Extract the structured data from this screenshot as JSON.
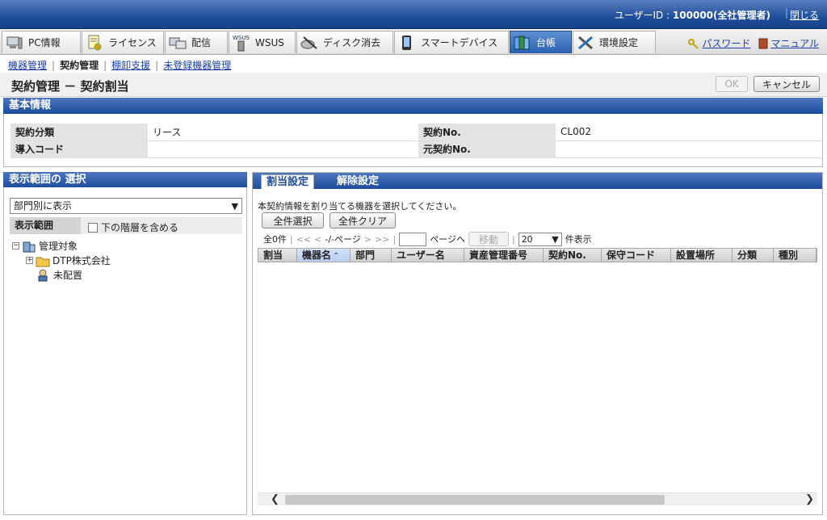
{
  "header": {
    "user_label": "ユーザーID : ",
    "user_id": "100000(全社管理者)",
    "close": "閉じる"
  },
  "nav": {
    "tabs": [
      {
        "label": "PC情報",
        "icon": "pc-icon"
      },
      {
        "label": "ライセンス",
        "icon": "license-icon"
      },
      {
        "label": "配信",
        "icon": "distribution-icon"
      },
      {
        "label": "WSUS",
        "icon": "wsus-icon"
      },
      {
        "label": "ディスク消去",
        "icon": "disk-erase-icon"
      },
      {
        "label": "スマートデバイス",
        "icon": "smart-device-icon"
      },
      {
        "label": "台帳",
        "icon": "ledger-icon"
      },
      {
        "label": "環境設定",
        "icon": "settings-icon"
      }
    ],
    "active_tab": "台帳",
    "password": "パスワード",
    "manual": "マニュアル"
  },
  "subnav": {
    "items": [
      "機器管理",
      "契約管理",
      "棚卸支援",
      "未登録機器管理"
    ],
    "current": "契約管理"
  },
  "page": {
    "title": "契約管理 － 契約割当",
    "ok": "OK",
    "cancel": "キャンセル"
  },
  "basic": {
    "heading": "基本情報",
    "rows": [
      {
        "label1": "契約分類",
        "value1": "リース",
        "label2": "契約No.",
        "value2": "CL002"
      },
      {
        "label1": "導入コード",
        "value1": "",
        "label2": "元契約No.",
        "value2": ""
      }
    ]
  },
  "scope": {
    "heading": "表示範囲の 選択",
    "select_value": "部門別に表示",
    "range_label": "表示範囲",
    "include_lower": "下の階層を含める",
    "tree": [
      "管理対象",
      "DTP株式会社",
      "未配置"
    ]
  },
  "assign": {
    "tab_assign": "割当設定",
    "tab_release": "解除設定",
    "instruction": "本契約情報を割り当てる機器を選択してください。",
    "select_all": "全件選択",
    "clear_all": "全件クリア",
    "pager": {
      "total": "全0件",
      "first": "<<",
      "prev": "<",
      "page_info": "-/-ページ",
      "next": ">",
      "last": ">>",
      "goto_suffix": "ページへ",
      "move": "移動",
      "per_page": "20",
      "per_page_suffix": "件表示"
    },
    "columns": [
      "割当",
      "機器名",
      "部門",
      "ユーザー名",
      "資産管理番号",
      "契約No.",
      "保守コード",
      "設置場所",
      "分類",
      "種別"
    ],
    "sorted_column": "機器名"
  },
  "colors": {
    "header_blue": "#1f4f9c",
    "link_blue": "#1a3fa6",
    "active_tab": "#2a62b2"
  }
}
